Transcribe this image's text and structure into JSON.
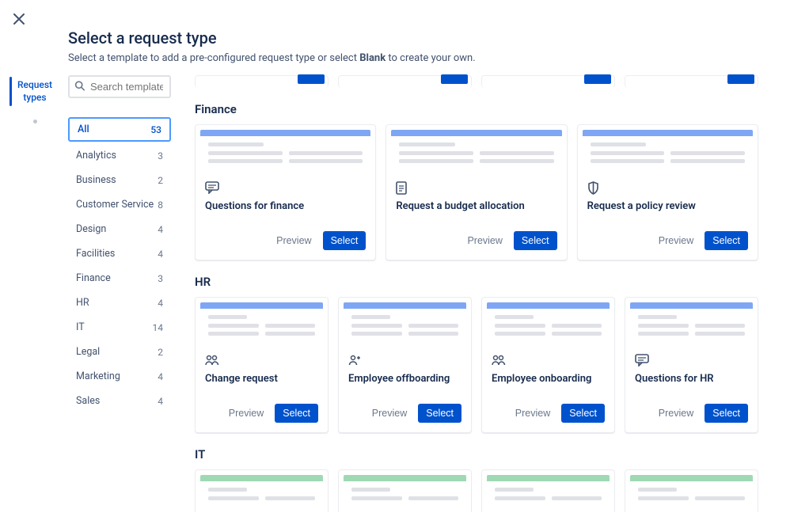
{
  "close_label": "Close",
  "header": {
    "title": "Select a request type",
    "description_prefix": "Select a template to add a pre-configured request type or select ",
    "description_bold": "Blank",
    "description_suffix": " to create your own."
  },
  "rail": {
    "item0": "Request types"
  },
  "search": {
    "placeholder": "Search templates"
  },
  "categories": [
    {
      "label": "All",
      "count": "53"
    },
    {
      "label": "Analytics",
      "count": "3"
    },
    {
      "label": "Business",
      "count": "2"
    },
    {
      "label": "Customer Service",
      "count": "8"
    },
    {
      "label": "Design",
      "count": "4"
    },
    {
      "label": "Facilities",
      "count": "4"
    },
    {
      "label": "Finance",
      "count": "3"
    },
    {
      "label": "HR",
      "count": "4"
    },
    {
      "label": "IT",
      "count": "14"
    },
    {
      "label": "Legal",
      "count": "2"
    },
    {
      "label": "Marketing",
      "count": "4"
    },
    {
      "label": "Sales",
      "count": "4"
    }
  ],
  "sections": {
    "finance": {
      "title": "Finance",
      "accent": "#7ea6f4",
      "cards": [
        {
          "title": "Questions for finance",
          "icon": "chat"
        },
        {
          "title": "Request a budget allocation",
          "icon": "doc"
        },
        {
          "title": "Request a policy review",
          "icon": "shield"
        }
      ]
    },
    "hr": {
      "title": "HR",
      "accent": "#7ea6f4",
      "cards": [
        {
          "title": "Change request",
          "icon": "people"
        },
        {
          "title": "Employee offboarding",
          "icon": "person-plus"
        },
        {
          "title": "Employee onboarding",
          "icon": "people-small"
        },
        {
          "title": "Questions for HR",
          "icon": "chat"
        }
      ]
    },
    "it": {
      "title": "IT",
      "accent": "#9fd9b4"
    }
  },
  "buttons": {
    "preview": "Preview",
    "select": "Select"
  }
}
